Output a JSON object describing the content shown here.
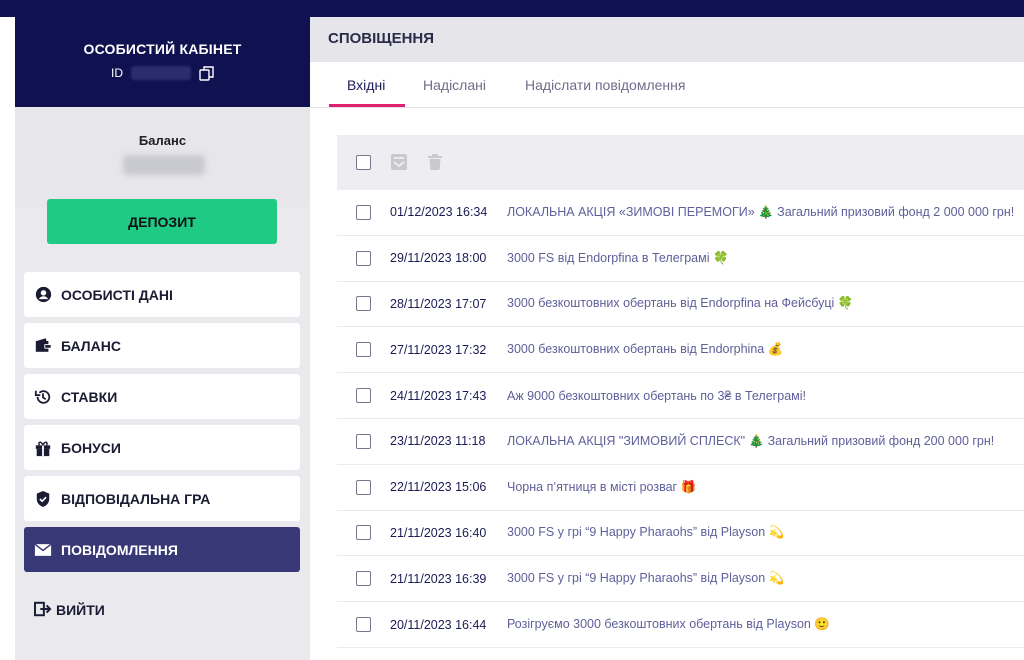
{
  "sidebar": {
    "profile_title": "ОСОБИСТИЙ КАБІНЕТ",
    "id_label": "ID",
    "balance_label": "Баланс",
    "deposit_label": "ДЕПОЗИТ",
    "menu": [
      {
        "label": "ОСОБИСТІ ДАНІ",
        "icon": "user-icon"
      },
      {
        "label": "БАЛАНС",
        "icon": "wallet-icon"
      },
      {
        "label": "СТАВКИ",
        "icon": "history-icon"
      },
      {
        "label": "БОНУСИ",
        "icon": "gift-icon"
      },
      {
        "label": "ВІДПОВІДАЛЬНА ГРА",
        "icon": "shield-icon"
      },
      {
        "label": "ПОВІДОМЛЕННЯ",
        "icon": "envelope-icon",
        "active": true
      }
    ],
    "logout_label": "ВИЙТИ"
  },
  "main": {
    "title": "СПОВІЩЕННЯ",
    "tabs": [
      {
        "label": "Вхідні",
        "active": true
      },
      {
        "label": "Надіслані"
      },
      {
        "label": "Надіслати повідомлення"
      }
    ],
    "messages": [
      {
        "date": "01/12/2023 16:34",
        "subject": "ЛОКАЛЬНА АКЦІЯ «ЗИМОВІ ПЕРЕМОГИ» 🎄 Загальний призовий фонд 2 000 000 грн!"
      },
      {
        "date": "29/11/2023 18:00",
        "subject": "3000 FS від Endorpfina в Телеграмі 🍀"
      },
      {
        "date": "28/11/2023 17:07",
        "subject": "3000 безкоштовних обертань від Endorpfina на Фейсбуці 🍀"
      },
      {
        "date": "27/11/2023 17:32",
        "subject": "3000 безкоштовних обертань від Endorphina 💰"
      },
      {
        "date": "24/11/2023 17:43",
        "subject": "Аж 9000 безкоштовних обертань по 3₴ в Телеграмі!"
      },
      {
        "date": "23/11/2023 11:18",
        "subject": "ЛОКАЛЬНА АКЦІЯ \"ЗИМОВИЙ СПЛЕСК\" 🎄 Загальний призовий фонд 200 000 грн!"
      },
      {
        "date": "22/11/2023 15:06",
        "subject": "Чорна п’ятниця в місті розваг 🎁"
      },
      {
        "date": "21/11/2023 16:40",
        "subject": "3000 FS у грі “9 Happy Pharaohs” від Playson 💫"
      },
      {
        "date": "21/11/2023 16:39",
        "subject": "3000 FS у грі “9 Happy Pharaohs” від Playson 💫"
      },
      {
        "date": "20/11/2023 16:44",
        "subject": "Розігруємо 3000 безкоштовних обертань від Playson 🙂"
      }
    ]
  },
  "colors": {
    "navy": "#0f1150",
    "deposit_green": "#1fca85",
    "active_menu": "#383877",
    "tab_underline": "#e0226e"
  }
}
